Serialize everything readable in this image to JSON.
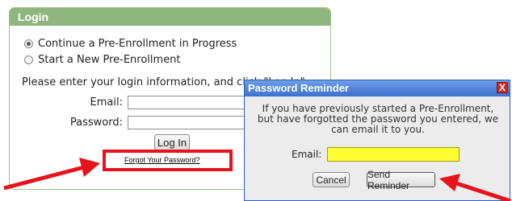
{
  "login": {
    "title": "Login",
    "options": [
      {
        "label": "Continue a Pre-Enrollment in Progress",
        "checked": true
      },
      {
        "label": "Start a New Pre-Enrollment",
        "checked": false
      }
    ],
    "instruction": "Please enter your login information, and click \"Log In\".",
    "email_label": "Email:",
    "password_label": "Password:",
    "login_button": "Log In",
    "forgot_link": "Forgot Your Password?"
  },
  "dialog": {
    "title": "Password Reminder",
    "close_icon": "X",
    "message_lines": [
      "If you have previously started a Pre-Enrollment,",
      "but have forgotted the password you entered, we",
      "can email it to you."
    ],
    "email_label": "Email:",
    "cancel_button": "Cancel",
    "send_button": "Send Reminder"
  },
  "colors": {
    "header_green": "#8fb67e",
    "highlight_red": "#e8121a",
    "dialog_title_blue": "#3c70d0",
    "email_field_yellow": "#ffff33"
  }
}
